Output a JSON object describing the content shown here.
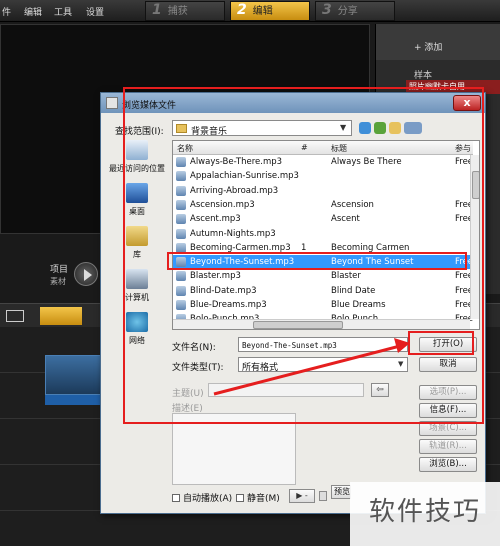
{
  "app": {
    "menus": [
      "编辑",
      "工具",
      "设置"
    ],
    "steps": [
      {
        "num": "1",
        "label": "捕获",
        "active": false
      },
      {
        "num": "2",
        "label": "编辑",
        "active": true
      },
      {
        "num": "3",
        "label": "分享",
        "active": false
      }
    ],
    "right_panel": {
      "add_label": "添加",
      "sample_label": "样本",
      "ribbon_label": "照片幽默卡自用"
    },
    "project_label": "项目",
    "material_label": "素材"
  },
  "dialog": {
    "title": "浏览媒体文件",
    "close_label": "x",
    "look_in_label": "查找范围(I):",
    "look_in_value": "背景音乐",
    "places": [
      "最近访问的位置",
      "桌面",
      "库",
      "计算机",
      "网络"
    ],
    "columns": [
      "名称",
      "#",
      "标题",
      "参与"
    ],
    "files": [
      {
        "name": "Always-Be-There.mp3",
        "num": "",
        "title": "Always Be There",
        "artist": "Free"
      },
      {
        "name": "Appalachian-Sunrise.mp3",
        "num": "",
        "title": "",
        "artist": ""
      },
      {
        "name": "Arriving-Abroad.mp3",
        "num": "",
        "title": "",
        "artist": ""
      },
      {
        "name": "Ascension.mp3",
        "num": "",
        "title": "Ascension",
        "artist": "Free"
      },
      {
        "name": "Ascent.mp3",
        "num": "",
        "title": "Ascent",
        "artist": "Free"
      },
      {
        "name": "Autumn-Nights.mp3",
        "num": "",
        "title": "",
        "artist": ""
      },
      {
        "name": "Becoming-Carmen.mp3",
        "num": "1",
        "title": "Becoming Carmen",
        "artist": ""
      },
      {
        "name": "Beyond-The-Sunset.mp3",
        "num": "",
        "title": "Beyond The Sunset",
        "artist": "Free"
      },
      {
        "name": "Blaster.mp3",
        "num": "",
        "title": "Blaster",
        "artist": "Free"
      },
      {
        "name": "Blind-Date.mp3",
        "num": "",
        "title": "Blind Date",
        "artist": "Free"
      },
      {
        "name": "Blue-Dreams.mp3",
        "num": "",
        "title": "Blue Dreams",
        "artist": "Free"
      },
      {
        "name": "Bolo-Punch.mp3",
        "num": "",
        "title": "Bolo Punch",
        "artist": "Free"
      }
    ],
    "selected_index": 7,
    "file_name_label": "文件名(N):",
    "file_name_value": "Beyond-The-Sunset.mp3",
    "file_type_label": "文件类型(T):",
    "file_type_value": "所有格式",
    "open_label": "打开(O)",
    "cancel_label": "取消",
    "subject_label": "主题(U)",
    "description_label": "描述(E)",
    "side_buttons": [
      "选项(P)...",
      "信息(F)...",
      "场景(C)...",
      "轨道(R)...",
      "浏览(B)..."
    ],
    "side_disabled": [
      true,
      false,
      true,
      true,
      false
    ],
    "autoplay_label": "自动播放(A)",
    "mute_label": "静音(M)",
    "play_label": "▶ -",
    "preview_label": "预览"
  },
  "watermark": "软件技巧",
  "colors": {
    "annotation": "#e51e1e",
    "selection": "#3399ff",
    "accent": "#f3c54a"
  }
}
